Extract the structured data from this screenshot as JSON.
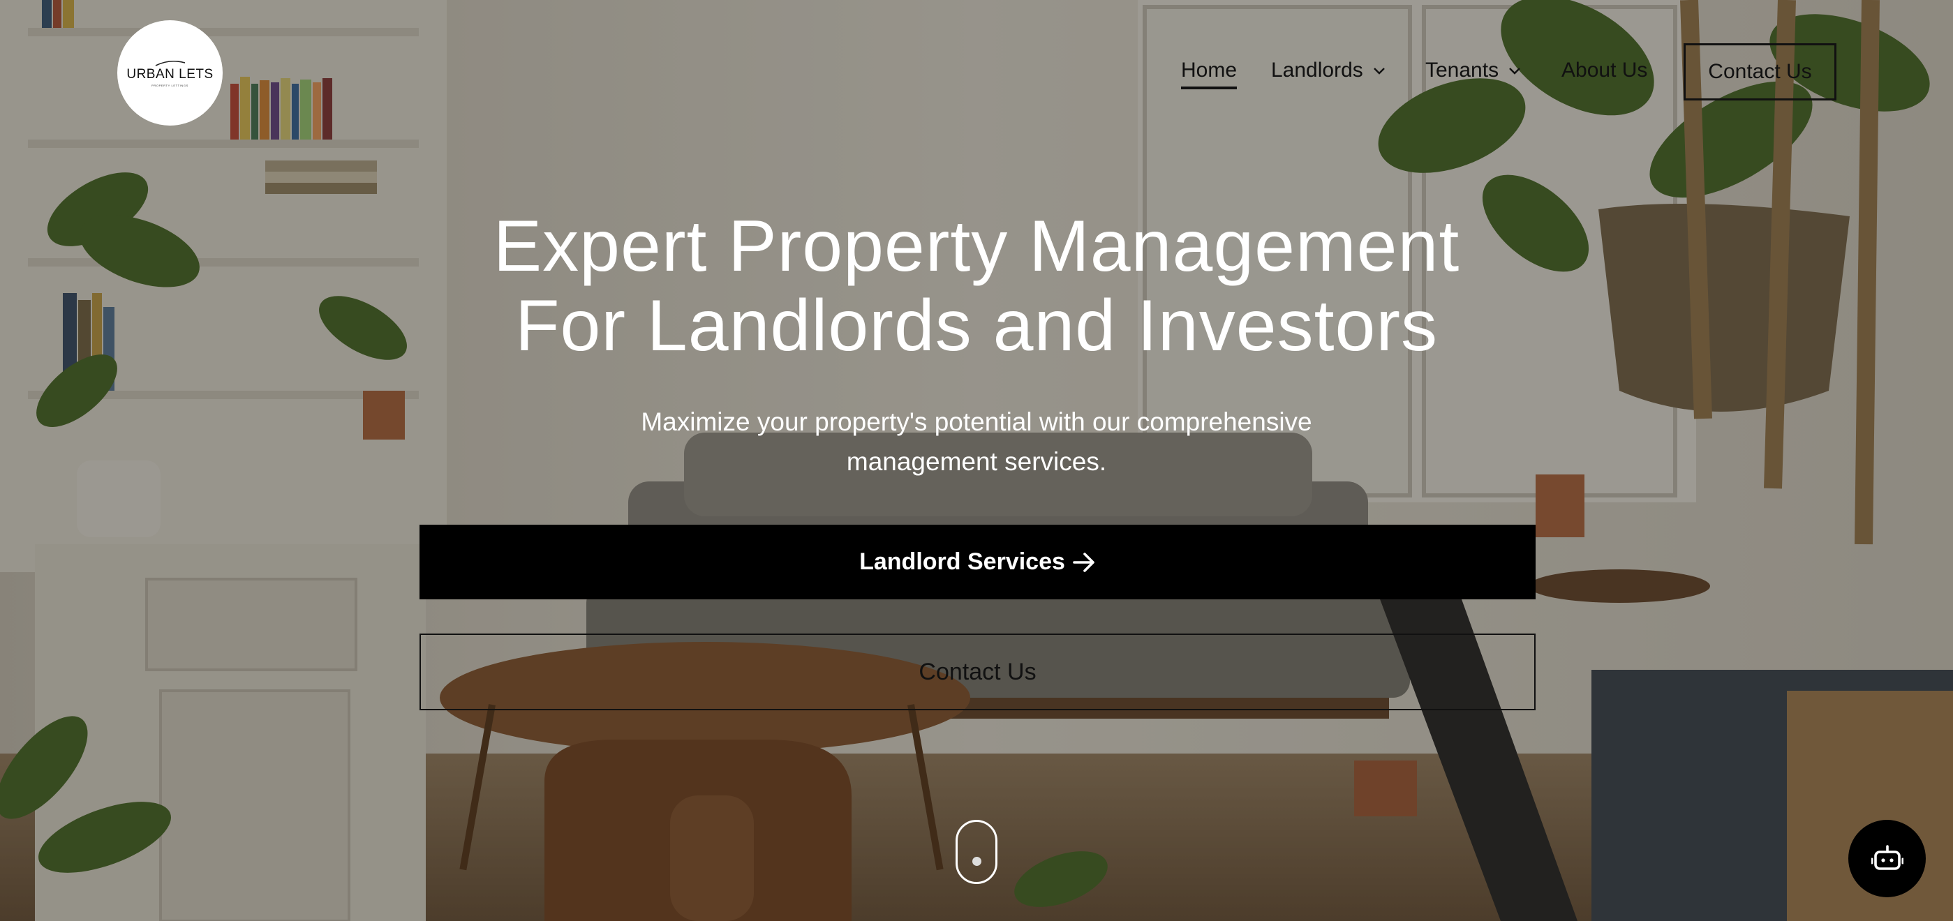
{
  "brand": {
    "logo_title": "URBAN LETS",
    "logo_subtitle": "PROPERTY LETTINGS"
  },
  "nav": {
    "items": [
      {
        "label": "Home",
        "active": true,
        "has_dropdown": false
      },
      {
        "label": "Landlords",
        "active": false,
        "has_dropdown": true
      },
      {
        "label": "Tenants",
        "active": false,
        "has_dropdown": true
      },
      {
        "label": "About Us",
        "active": false,
        "has_dropdown": false
      }
    ],
    "cta_label": "Contact Us"
  },
  "hero": {
    "title_line1": "Expert Property Management",
    "title_line2": "For Landlords and Investors",
    "subtitle_line1": "Maximize your property's potential with our comprehensive",
    "subtitle_line2": "management services.",
    "primary_button": "Landlord Services",
    "secondary_button": "Contact Us"
  },
  "icons": {
    "nav_dropdown": "chevron-down-icon",
    "primary_arrow": "arrow-right-icon",
    "scroll": "mouse-scroll-icon",
    "chat": "robot-icon"
  },
  "colors": {
    "primary_button_bg": "#000000",
    "text_on_hero": "#ffffff",
    "nav_text": "#111111"
  }
}
